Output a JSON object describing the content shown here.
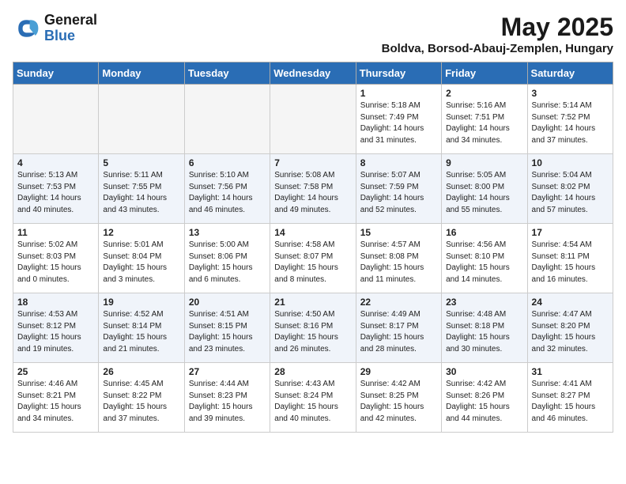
{
  "header": {
    "logo_line1": "General",
    "logo_line2": "Blue",
    "month": "May 2025",
    "location": "Boldva, Borsod-Abauj-Zemplen, Hungary"
  },
  "weekdays": [
    "Sunday",
    "Monday",
    "Tuesday",
    "Wednesday",
    "Thursday",
    "Friday",
    "Saturday"
  ],
  "weeks": [
    [
      {
        "day": "",
        "info": ""
      },
      {
        "day": "",
        "info": ""
      },
      {
        "day": "",
        "info": ""
      },
      {
        "day": "",
        "info": ""
      },
      {
        "day": "1",
        "info": "Sunrise: 5:18 AM\nSunset: 7:49 PM\nDaylight: 14 hours\nand 31 minutes."
      },
      {
        "day": "2",
        "info": "Sunrise: 5:16 AM\nSunset: 7:51 PM\nDaylight: 14 hours\nand 34 minutes."
      },
      {
        "day": "3",
        "info": "Sunrise: 5:14 AM\nSunset: 7:52 PM\nDaylight: 14 hours\nand 37 minutes."
      }
    ],
    [
      {
        "day": "4",
        "info": "Sunrise: 5:13 AM\nSunset: 7:53 PM\nDaylight: 14 hours\nand 40 minutes."
      },
      {
        "day": "5",
        "info": "Sunrise: 5:11 AM\nSunset: 7:55 PM\nDaylight: 14 hours\nand 43 minutes."
      },
      {
        "day": "6",
        "info": "Sunrise: 5:10 AM\nSunset: 7:56 PM\nDaylight: 14 hours\nand 46 minutes."
      },
      {
        "day": "7",
        "info": "Sunrise: 5:08 AM\nSunset: 7:58 PM\nDaylight: 14 hours\nand 49 minutes."
      },
      {
        "day": "8",
        "info": "Sunrise: 5:07 AM\nSunset: 7:59 PM\nDaylight: 14 hours\nand 52 minutes."
      },
      {
        "day": "9",
        "info": "Sunrise: 5:05 AM\nSunset: 8:00 PM\nDaylight: 14 hours\nand 55 minutes."
      },
      {
        "day": "10",
        "info": "Sunrise: 5:04 AM\nSunset: 8:02 PM\nDaylight: 14 hours\nand 57 minutes."
      }
    ],
    [
      {
        "day": "11",
        "info": "Sunrise: 5:02 AM\nSunset: 8:03 PM\nDaylight: 15 hours\nand 0 minutes."
      },
      {
        "day": "12",
        "info": "Sunrise: 5:01 AM\nSunset: 8:04 PM\nDaylight: 15 hours\nand 3 minutes."
      },
      {
        "day": "13",
        "info": "Sunrise: 5:00 AM\nSunset: 8:06 PM\nDaylight: 15 hours\nand 6 minutes."
      },
      {
        "day": "14",
        "info": "Sunrise: 4:58 AM\nSunset: 8:07 PM\nDaylight: 15 hours\nand 8 minutes."
      },
      {
        "day": "15",
        "info": "Sunrise: 4:57 AM\nSunset: 8:08 PM\nDaylight: 15 hours\nand 11 minutes."
      },
      {
        "day": "16",
        "info": "Sunrise: 4:56 AM\nSunset: 8:10 PM\nDaylight: 15 hours\nand 14 minutes."
      },
      {
        "day": "17",
        "info": "Sunrise: 4:54 AM\nSunset: 8:11 PM\nDaylight: 15 hours\nand 16 minutes."
      }
    ],
    [
      {
        "day": "18",
        "info": "Sunrise: 4:53 AM\nSunset: 8:12 PM\nDaylight: 15 hours\nand 19 minutes."
      },
      {
        "day": "19",
        "info": "Sunrise: 4:52 AM\nSunset: 8:14 PM\nDaylight: 15 hours\nand 21 minutes."
      },
      {
        "day": "20",
        "info": "Sunrise: 4:51 AM\nSunset: 8:15 PM\nDaylight: 15 hours\nand 23 minutes."
      },
      {
        "day": "21",
        "info": "Sunrise: 4:50 AM\nSunset: 8:16 PM\nDaylight: 15 hours\nand 26 minutes."
      },
      {
        "day": "22",
        "info": "Sunrise: 4:49 AM\nSunset: 8:17 PM\nDaylight: 15 hours\nand 28 minutes."
      },
      {
        "day": "23",
        "info": "Sunrise: 4:48 AM\nSunset: 8:18 PM\nDaylight: 15 hours\nand 30 minutes."
      },
      {
        "day": "24",
        "info": "Sunrise: 4:47 AM\nSunset: 8:20 PM\nDaylight: 15 hours\nand 32 minutes."
      }
    ],
    [
      {
        "day": "25",
        "info": "Sunrise: 4:46 AM\nSunset: 8:21 PM\nDaylight: 15 hours\nand 34 minutes."
      },
      {
        "day": "26",
        "info": "Sunrise: 4:45 AM\nSunset: 8:22 PM\nDaylight: 15 hours\nand 37 minutes."
      },
      {
        "day": "27",
        "info": "Sunrise: 4:44 AM\nSunset: 8:23 PM\nDaylight: 15 hours\nand 39 minutes."
      },
      {
        "day": "28",
        "info": "Sunrise: 4:43 AM\nSunset: 8:24 PM\nDaylight: 15 hours\nand 40 minutes."
      },
      {
        "day": "29",
        "info": "Sunrise: 4:42 AM\nSunset: 8:25 PM\nDaylight: 15 hours\nand 42 minutes."
      },
      {
        "day": "30",
        "info": "Sunrise: 4:42 AM\nSunset: 8:26 PM\nDaylight: 15 hours\nand 44 minutes."
      },
      {
        "day": "31",
        "info": "Sunrise: 4:41 AM\nSunset: 8:27 PM\nDaylight: 15 hours\nand 46 minutes."
      }
    ]
  ]
}
